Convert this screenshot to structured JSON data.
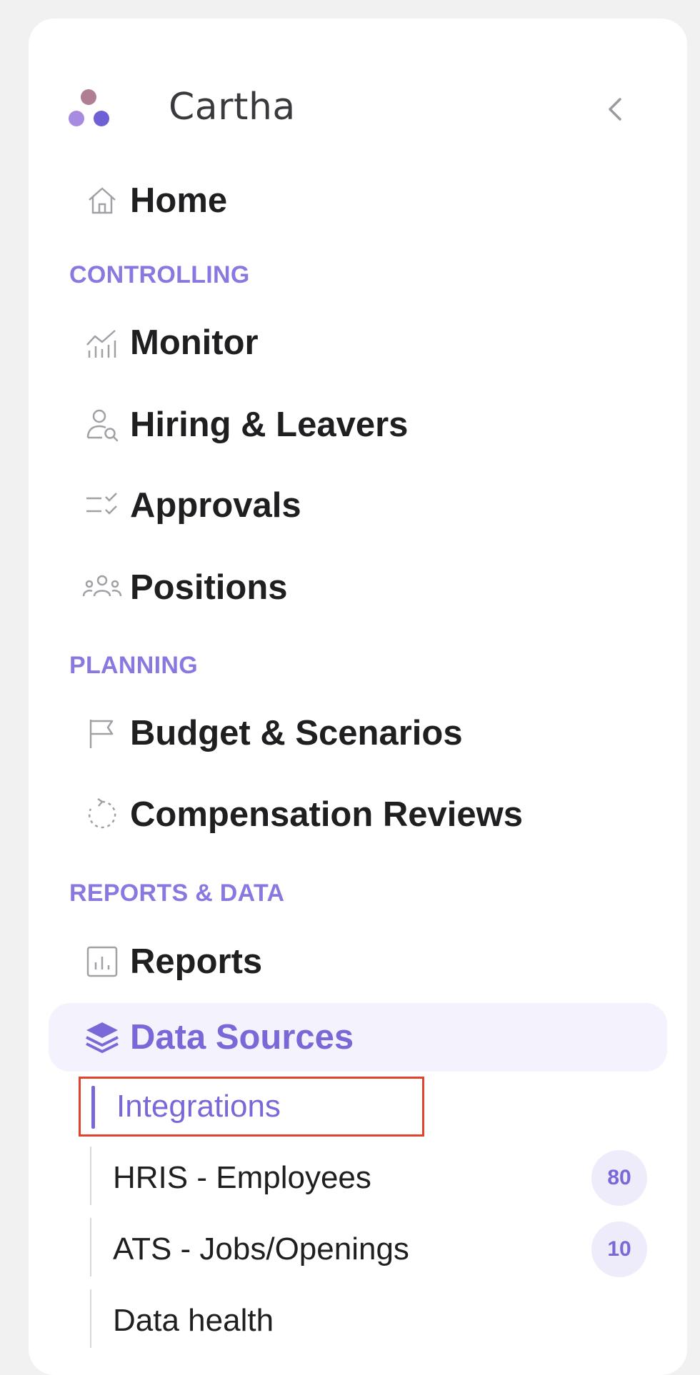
{
  "brand": {
    "name": "Cartha"
  },
  "nav": {
    "home": {
      "label": "Home",
      "icon": "home-icon"
    },
    "sections": [
      {
        "title": "CONTROLLING"
      },
      {
        "title": "PLANNING"
      },
      {
        "title": "REPORTS & DATA"
      }
    ],
    "items": [
      {
        "label": "Monitor",
        "icon": "chart-trend-icon"
      },
      {
        "label": "Hiring & Leavers",
        "icon": "user-search-icon"
      },
      {
        "label": "Approvals",
        "icon": "checklist-icon"
      },
      {
        "label": "Positions",
        "icon": "team-icon"
      },
      {
        "label": "Budget & Scenarios",
        "icon": "flag-icon"
      },
      {
        "label": "Compensation Reviews",
        "icon": "refresh-icon"
      },
      {
        "label": "Reports",
        "icon": "bar-chart-icon"
      }
    ],
    "active": {
      "label": "Data Sources",
      "icon": "layers-icon"
    },
    "sub_items": [
      {
        "label": "Integrations"
      },
      {
        "label": "HRIS - Employees",
        "badge": "80"
      },
      {
        "label": "ATS - Jobs/Openings",
        "badge": "10"
      },
      {
        "label": "Data health"
      }
    ]
  },
  "colors": {
    "accent": "#7b68d8",
    "active_bg": "#f4f2fd",
    "highlight_border": "#e0442e"
  }
}
